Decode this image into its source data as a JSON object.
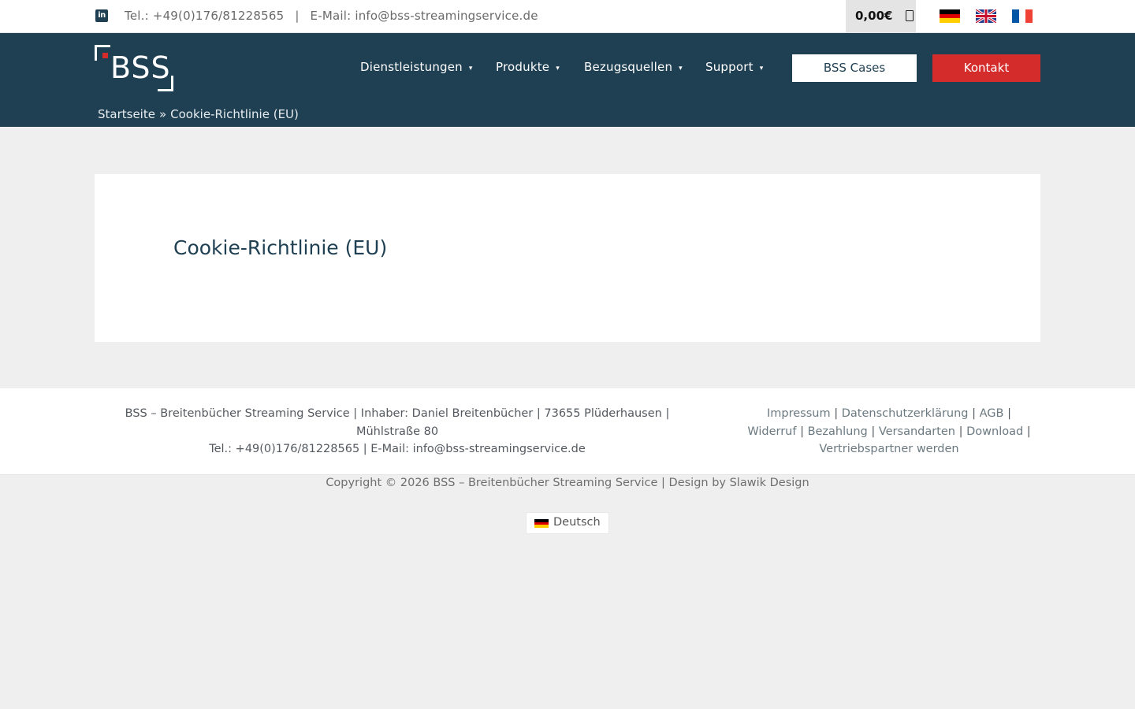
{
  "topbar": {
    "linkedin_icon": "linkedin-icon",
    "phone": "Tel.: +49(0)176/81228565",
    "separator": "|",
    "email": "E-Mail: info@bss-streamingservice.de",
    "cart_amount": "0,00€",
    "cart_icon": "shopping-bag-icon",
    "languages": [
      "de",
      "en",
      "fr"
    ]
  },
  "header": {
    "logo_text": "BSS",
    "nav": [
      {
        "label": "Dienstleistungen"
      },
      {
        "label": "Produkte"
      },
      {
        "label": "Bezugsquellen"
      },
      {
        "label": "Support"
      }
    ],
    "nav_caret": "▾",
    "cases_button": "BSS Cases",
    "contact_button": "Kontakt",
    "breadcrumb": {
      "home": "Startseite",
      "separator": "»",
      "current": "Cookie-Richtlinie (EU)"
    }
  },
  "main": {
    "title": "Cookie-Richtlinie (EU)"
  },
  "footer": {
    "address_line1": "BSS – Breitenbücher Streaming Service | Inhaber: Daniel Breitenbücher | 73655 Plüderhausen |",
    "address_line2": "Mühlstraße 80",
    "address_line3": "Tel.: +49(0)176/81228565 | E-Mail: info@bss-streamingservice.de",
    "links": [
      "Impressum",
      "Datenschutzerklärung",
      "AGB",
      "Widerruf",
      "Bezahlung",
      "Versandarten",
      "Download",
      "Vertriebspartner werden"
    ],
    "pipe": "|",
    "copyright": "Copyright © 2026 BSS – Breitenbücher Streaming Service | Design by Slawik Design",
    "language_switch": "Deutsch"
  },
  "colors": {
    "header_bg": "#1f3f52",
    "accent_red": "#d42b2b",
    "page_bg": "#efefef"
  }
}
